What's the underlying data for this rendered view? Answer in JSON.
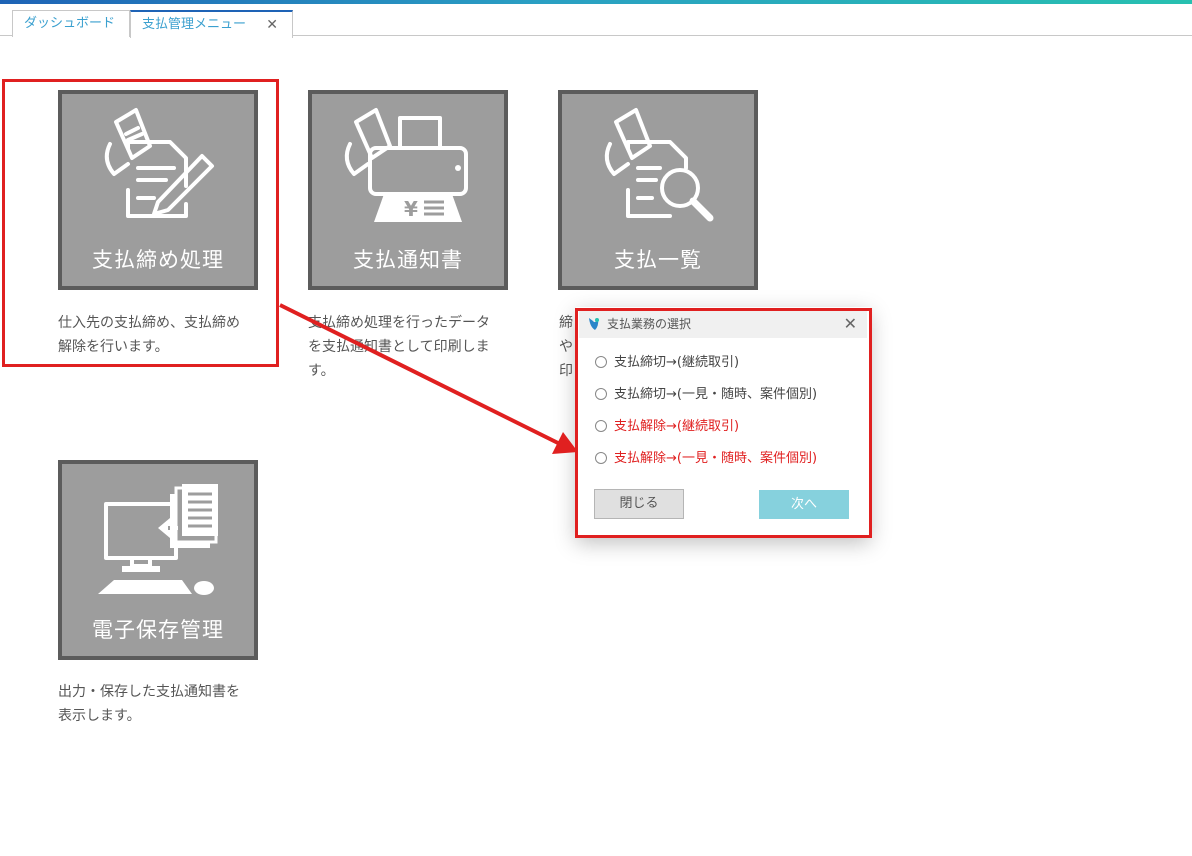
{
  "tabs": [
    {
      "label": "ダッシュボード"
    },
    {
      "label": "支払管理メニュー",
      "close": "✕"
    }
  ],
  "tiles": [
    {
      "label": "支払締め処理",
      "desc_lines": [
        "仕入先の支払締め、支払締め",
        "解除を行います。"
      ]
    },
    {
      "label": "支払通知書",
      "desc_lines": [
        "支払締め処理を行ったデータ",
        "を支払通知書として印刷しま",
        "す。"
      ]
    },
    {
      "label": "支払一覧",
      "desc_lines": [
        "締",
        "や",
        "印"
      ]
    },
    {
      "label": "電子保存管理",
      "desc_lines": [
        "出力・保存した支払通知書を",
        "表示します。"
      ]
    }
  ],
  "dialog": {
    "title": "支払業務の選択",
    "options": [
      {
        "label": "支払締切→(継続取引)",
        "color": "#444444"
      },
      {
        "label": "支払締切→(一見・随時、案件個別)",
        "color": "#444444"
      },
      {
        "label": "支払解除→(継続取引)",
        "color": "#e02020"
      },
      {
        "label": "支払解除→(一見・随時、案件個別)",
        "color": "#e02020"
      }
    ],
    "close_button": "閉じる",
    "next_button": "次へ"
  },
  "icons": [
    "document-pen-icon",
    "fax-print-icon",
    "document-search-icon",
    "computer-archive-icon",
    "app-logo-icon",
    "close-icon"
  ],
  "colors": {
    "highlight": "#e02020",
    "tile_bg": "#9d9d9d",
    "tab_text": "#3ba0cf",
    "next_button": "#86d1dd"
  }
}
